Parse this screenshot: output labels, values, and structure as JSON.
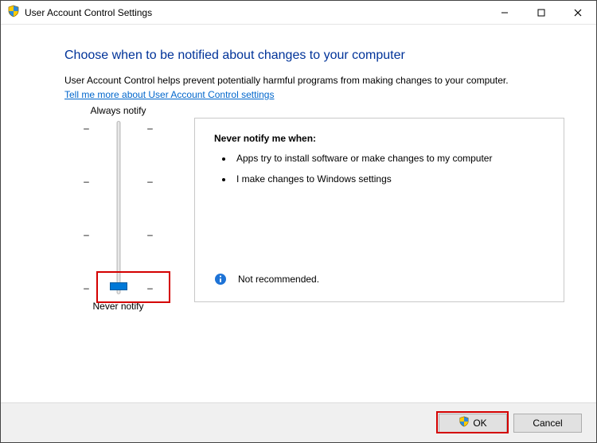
{
  "titlebar": {
    "title": "User Account Control Settings"
  },
  "main": {
    "heading": "Choose when to be notified about changes to your computer",
    "description": "User Account Control helps prevent potentially harmful programs from making changes to your computer.",
    "help_link": "Tell me more about User Account Control settings"
  },
  "slider": {
    "top_label": "Always notify",
    "bottom_label": "Never notify"
  },
  "panel": {
    "title": "Never notify me when:",
    "items": [
      "Apps try to install software or make changes to my computer",
      "I make changes to Windows settings"
    ],
    "footer": "Not recommended."
  },
  "buttons": {
    "ok": "OK",
    "cancel": "Cancel"
  }
}
